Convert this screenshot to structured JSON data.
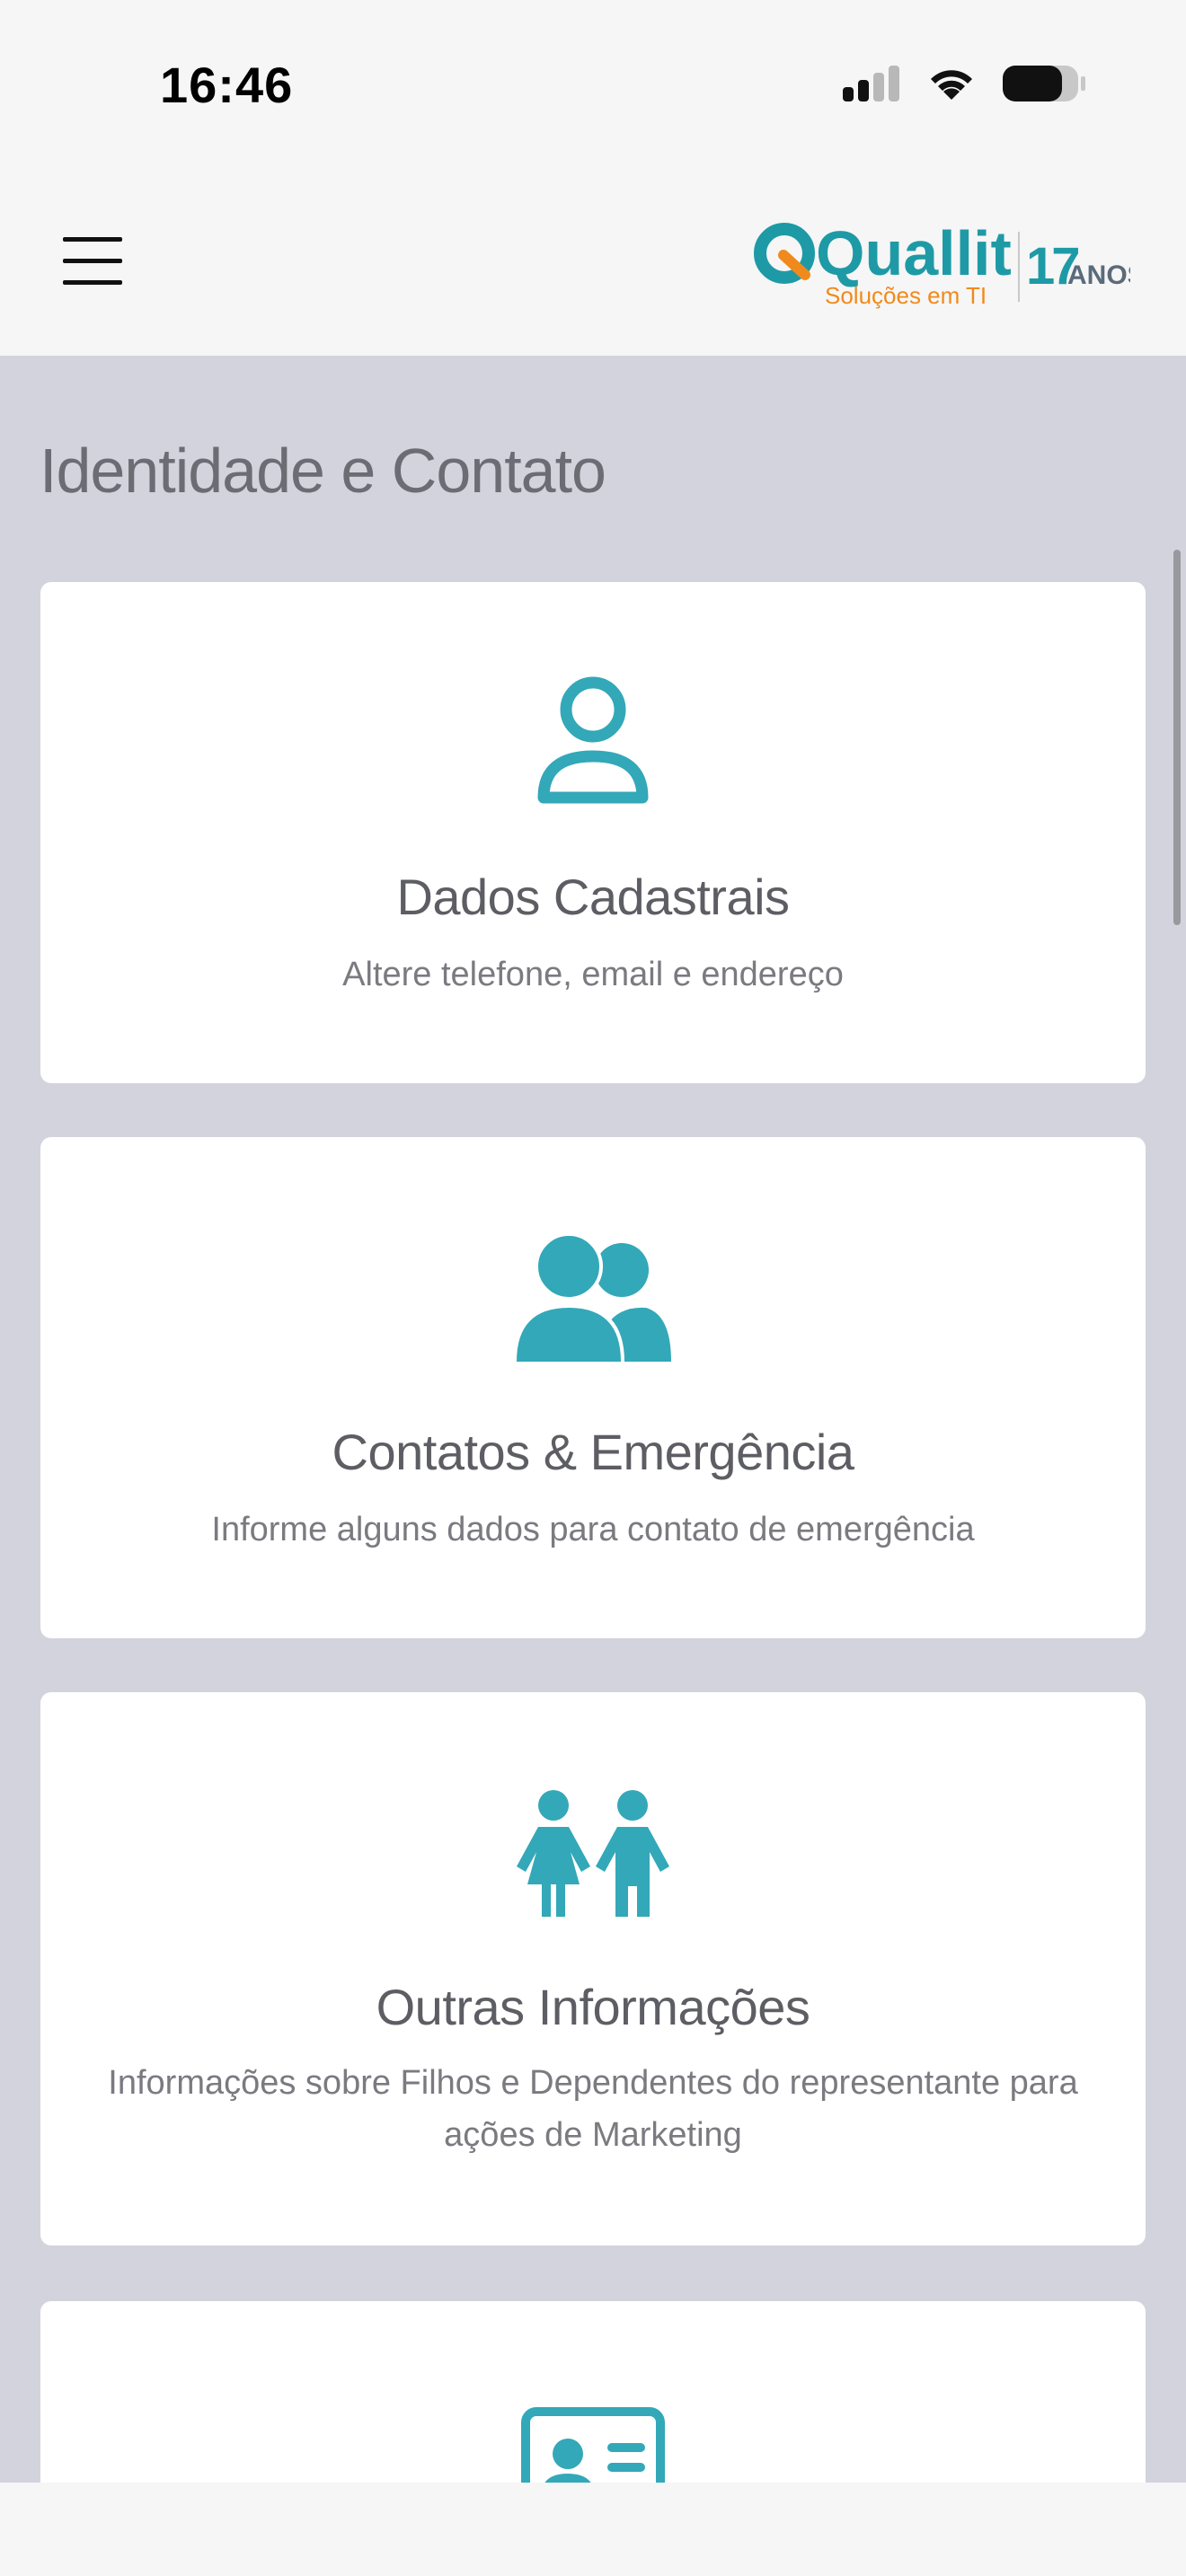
{
  "status_bar": {
    "time": "16:46"
  },
  "header": {
    "logo_text": "Quallit",
    "logo_tagline": "Soluções em TI",
    "anniversary_number": "17",
    "anniversary_word": "ANOS"
  },
  "page": {
    "title": "Identidade e Contato"
  },
  "cards": [
    {
      "icon": "user-icon",
      "title": "Dados Cadastrais",
      "description": "Altere telefone, email e endereço"
    },
    {
      "icon": "users-icon",
      "title": "Contatos & Emergência",
      "description": "Informe alguns dados para contato de emergência"
    },
    {
      "icon": "children-icon",
      "title": "Outras Informações",
      "description": "Informações sobre Filhos e Dependentes do representante para ações de Marketing"
    },
    {
      "icon": "id-card-icon",
      "title": "",
      "description": ""
    }
  ],
  "colors": {
    "accent": "#33a8b8",
    "brand_orange": "#f08a1d",
    "brand_teal": "#1e9aa6",
    "anos_gray": "#5a6b7a",
    "background": "#d3d3dd"
  }
}
